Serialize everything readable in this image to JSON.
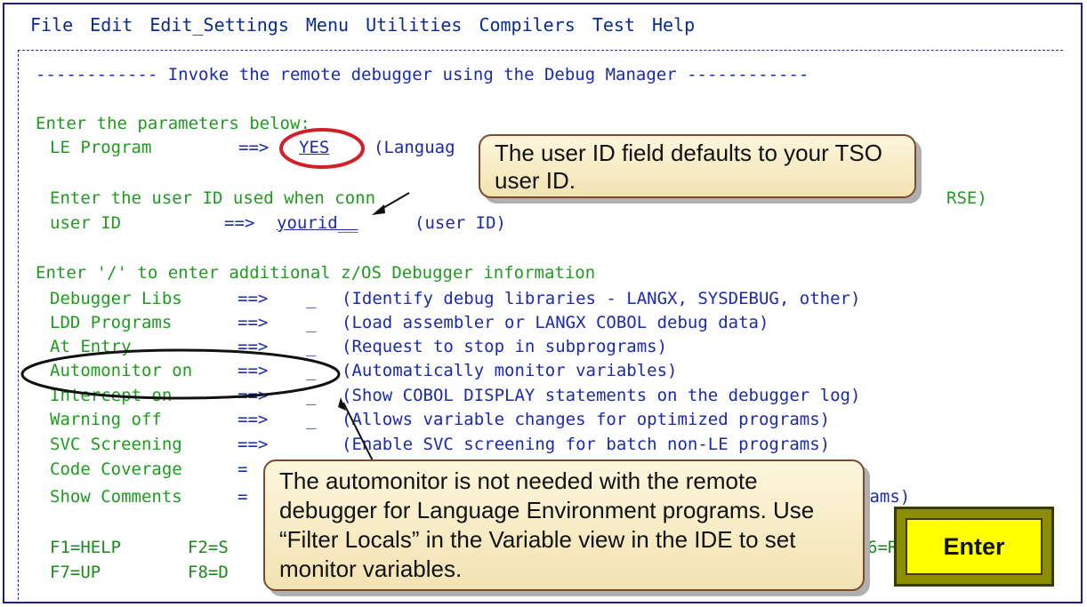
{
  "menu": [
    "File",
    "Edit",
    "Edit_Settings",
    "Menu",
    "Utilities",
    "Compilers",
    "Test",
    "Help"
  ],
  "screen": {
    "title_line": "------------ Invoke the remote debugger using the Debug Manager ------------",
    "params_header": "Enter the parameters below:",
    "le_program": {
      "label": "LE Program",
      "arrow": "==>",
      "value": "YES",
      "hint": "(Languag"
    },
    "userid_prompt": "Enter the user ID used when conn",
    "userid_prompt_tail": "RSE)",
    "userid": {
      "label": "user ID",
      "arrow": "==>",
      "value": "yourid__",
      "hint": "(user ID)"
    },
    "additional_header": "Enter '/' to enter additional z/OS Debugger information",
    "options": [
      {
        "label": "Debugger Libs",
        "arrow": "==>",
        "value": "_",
        "desc": "(Identify debug libraries - LANGX, SYSDEBUG, other)"
      },
      {
        "label": "LDD Programs",
        "arrow": "==>",
        "value": "_",
        "desc": "(Load assembler or LANGX COBOL debug data)"
      },
      {
        "label": "At Entry",
        "arrow": "==>",
        "value": "_",
        "desc": "(Request to stop in subprograms)"
      },
      {
        "label": "Automonitor on",
        "arrow": "==>",
        "value": "_",
        "desc": "(Automatically monitor variables)"
      },
      {
        "label": "Intercept on",
        "arrow": "==>",
        "value": "_",
        "desc": "(Show COBOL DISPLAY statements on the debugger log)"
      },
      {
        "label": "Warning off",
        "arrow": "==>",
        "value": "_",
        "desc": "(Allows variable changes for optimized programs)"
      },
      {
        "label": "SVC Screening",
        "arrow": "==>",
        "value": "",
        "desc": "(Enable SVC screening for batch non-LE programs)"
      },
      {
        "label": "Code Coverage",
        "arrow": "=",
        "value": "",
        "desc": ""
      },
      {
        "label": "Show Comments",
        "arrow": "=",
        "value": "",
        "desc": "rams)"
      }
    ],
    "fkeys_row1": {
      "left": "F1=HELP",
      "mid": "F2=S",
      "right": "6=R"
    },
    "fkeys_row2": {
      "left": "F7=UP",
      "mid": "F8=D"
    }
  },
  "callouts": {
    "top": "The user ID field defaults to your TSO user ID.",
    "bottom": "The automonitor is not needed with the remote debugger for Language Environment programs. Use “Filter Locals” in the Variable view in the IDE to set monitor variables."
  },
  "enter_button": "Enter",
  "colors": {
    "menu": "#0a2a8f",
    "field_text": "#1e9b1e",
    "value_text": "#1a2aa8",
    "highlight_circle": "#d0202a",
    "callout_bg": "#f6ebc5",
    "enter_bg": "#ffff00"
  }
}
